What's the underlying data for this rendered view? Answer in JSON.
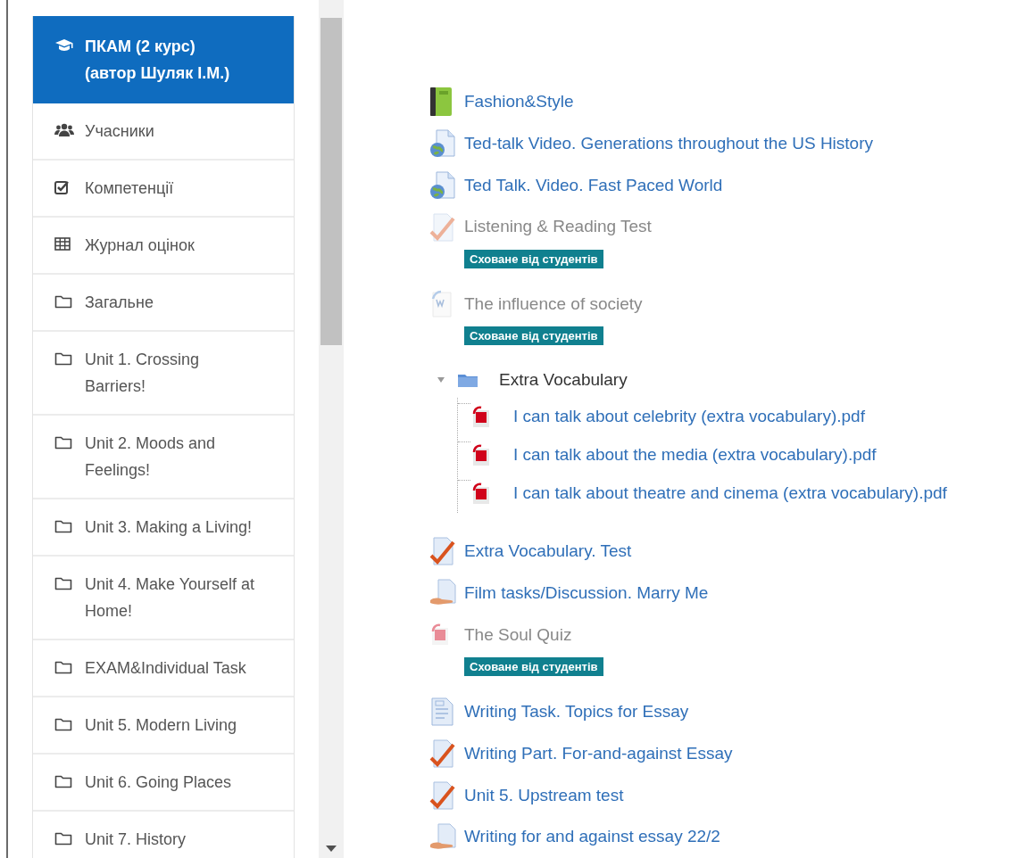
{
  "sidebar": {
    "items": [
      {
        "label": "ПКАМ (2 курс)\n(автор Шуляк І.М.)",
        "kind": "course",
        "selected": true
      },
      {
        "label": "Учасники",
        "kind": "participants",
        "selected": false
      },
      {
        "label": "Компетенції",
        "kind": "competencies",
        "selected": false
      },
      {
        "label": "Журнал оцінок",
        "kind": "grades",
        "selected": false
      },
      {
        "label": "Загальне",
        "kind": "section",
        "selected": false
      },
      {
        "label": "Unit 1. Crossing\nBarriers!",
        "kind": "section",
        "selected": false
      },
      {
        "label": "Unit 2. Moods and\nFeelings!",
        "kind": "section",
        "selected": false
      },
      {
        "label": "Unit 3. Making a Living!",
        "kind": "section",
        "selected": false
      },
      {
        "label": "Unit 4. Make Yourself at\nHome!",
        "kind": "section",
        "selected": false
      },
      {
        "label": "EXAM&Individual Task",
        "kind": "section",
        "selected": false
      },
      {
        "label": "Unit 5. Modern Living",
        "kind": "section",
        "selected": false
      },
      {
        "label": "Unit 6. Going Places",
        "kind": "section",
        "selected": false
      },
      {
        "label": "Unit 7. History",
        "kind": "section",
        "selected": false
      }
    ]
  },
  "activities": [
    {
      "kind": "book",
      "title": "Fashion&Style",
      "hidden": false
    },
    {
      "kind": "url",
      "title": "Ted-talk Video. Generations throughout the US History",
      "hidden": false
    },
    {
      "kind": "url",
      "title": "Ted Talk. Video. Fast Paced World",
      "hidden": false
    },
    {
      "kind": "quiz",
      "title": "Listening & Reading Test",
      "hidden": true,
      "badge": "Сховане від студентів"
    },
    {
      "kind": "word",
      "title": "The influence of society",
      "hidden": true,
      "badge": "Сховане від студентів"
    },
    {
      "kind": "folder",
      "title": "Extra Vocabulary",
      "hidden": false,
      "expanded": true,
      "children": [
        {
          "kind": "pdf",
          "title": "I can talk about celebrity (extra vocabulary).pdf"
        },
        {
          "kind": "pdf",
          "title": "I can talk about the media (extra vocabulary).pdf"
        },
        {
          "kind": "pdf",
          "title": "I can talk about theatre and cinema (extra vocabulary).pdf"
        }
      ]
    },
    {
      "kind": "quiz",
      "title": "Extra Vocabulary. Test",
      "hidden": false
    },
    {
      "kind": "assign",
      "title": "Film tasks/Discussion. Marry Me",
      "hidden": false
    },
    {
      "kind": "pdf",
      "title": "The Soul Quiz",
      "hidden": true,
      "badge": "Сховане від студентів"
    },
    {
      "kind": "page",
      "title": "Writing Task. Topics for Essay",
      "hidden": false
    },
    {
      "kind": "quiz",
      "title": "Writing Part. For-and-against Essay",
      "hidden": false
    },
    {
      "kind": "quiz",
      "title": "Unit 5. Upstream test",
      "hidden": false
    },
    {
      "kind": "assign",
      "title": "Writing for and against essay 22/2",
      "hidden": false
    }
  ]
}
